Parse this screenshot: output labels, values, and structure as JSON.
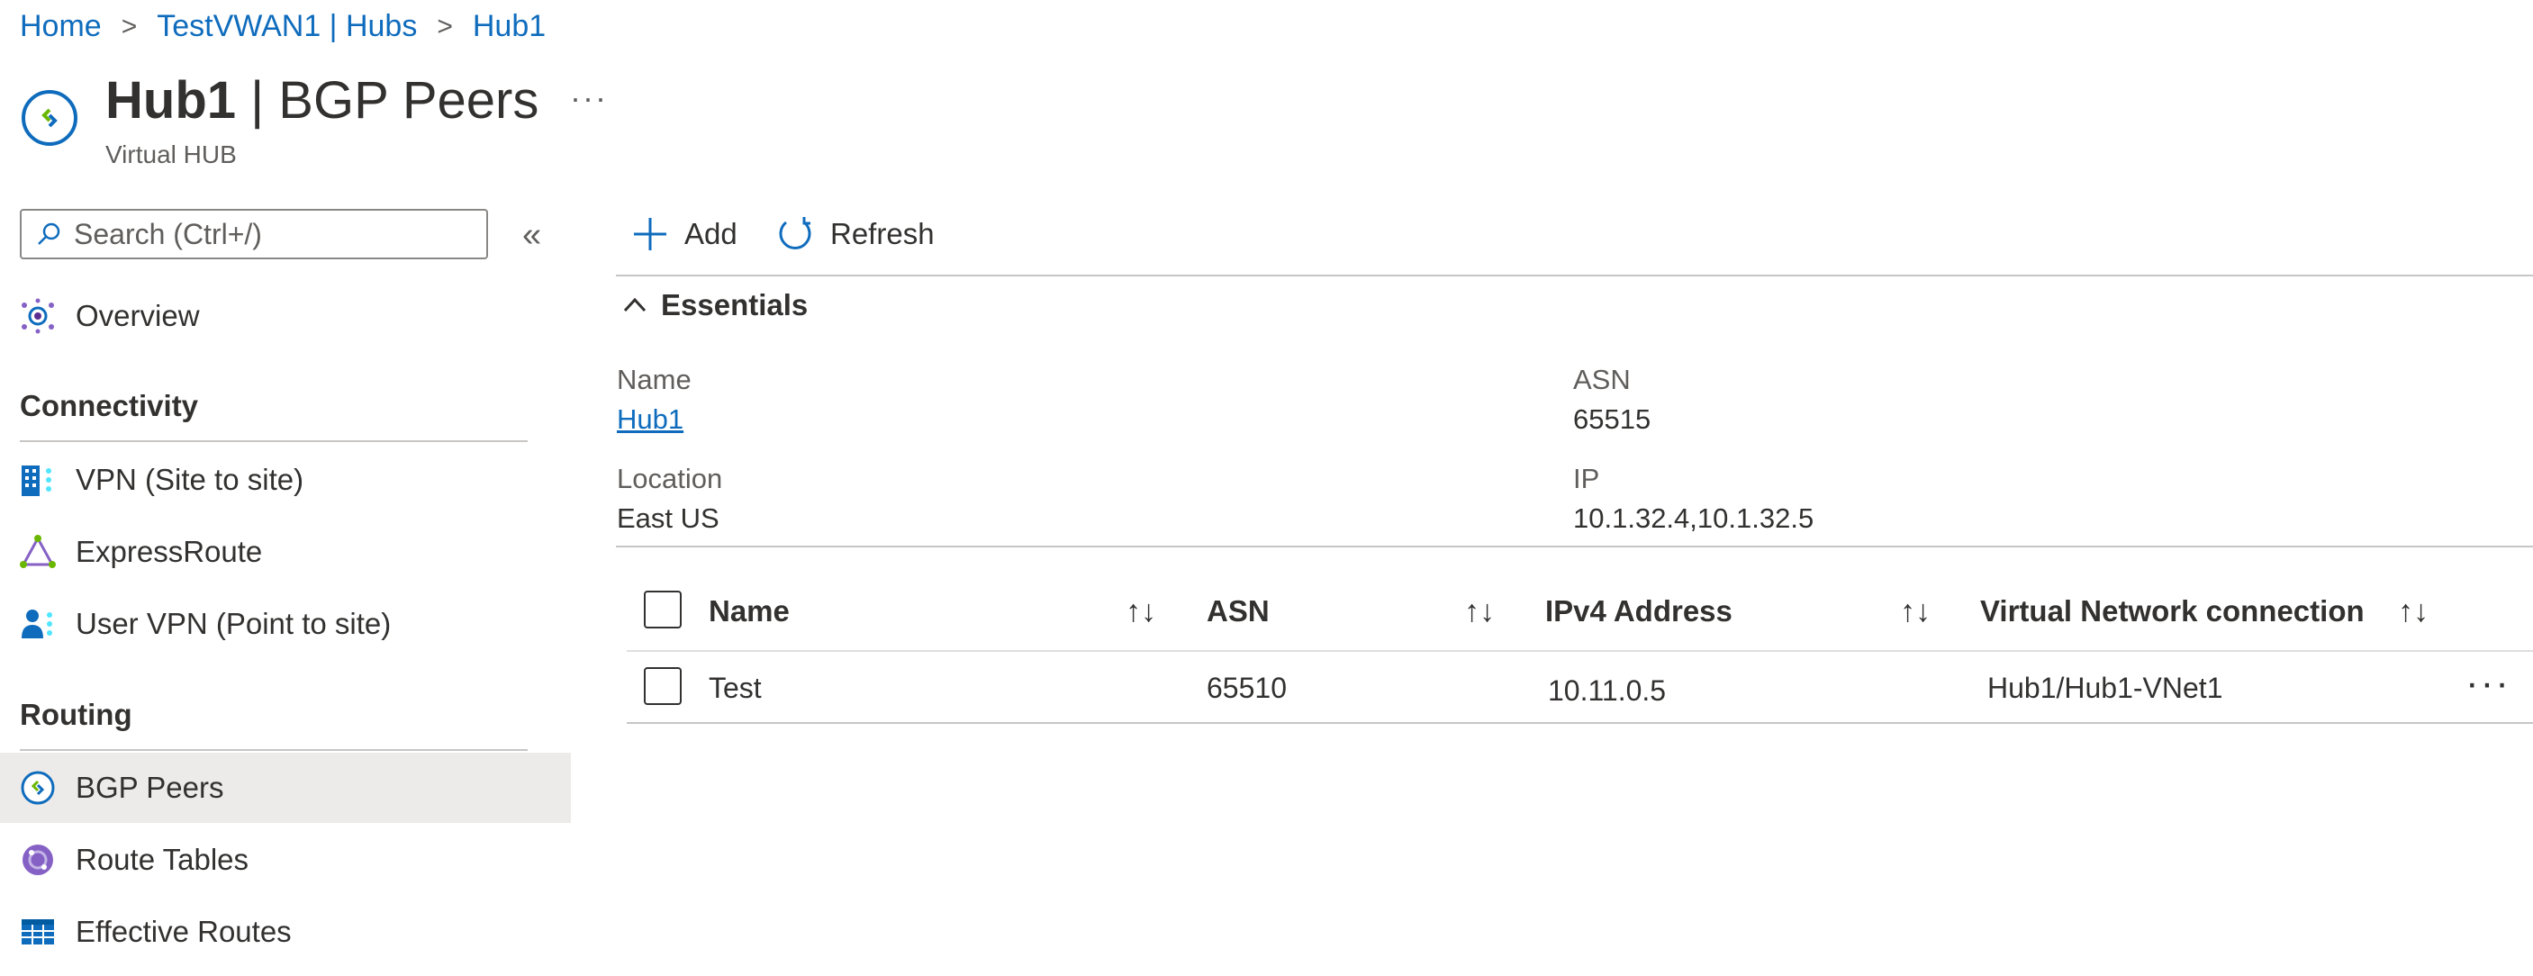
{
  "breadcrumb": [
    "Home",
    "TestVWAN1 | Hubs",
    "Hub1"
  ],
  "header": {
    "title_bold": "Hub1",
    "title_rest": "| BGP Peers",
    "subtitle": "Virtual HUB",
    "more": "···"
  },
  "sidebar": {
    "search_placeholder": "Search (Ctrl+/)",
    "collapse": "«",
    "overview": "Overview",
    "sections": [
      {
        "title": "Connectivity",
        "items": [
          "VPN (Site to site)",
          "ExpressRoute",
          "User VPN (Point to site)"
        ]
      },
      {
        "title": "Routing",
        "items": [
          "BGP Peers",
          "Route Tables",
          "Effective Routes"
        ]
      }
    ],
    "active_item": "BGP Peers"
  },
  "toolbar": {
    "add": "Add",
    "refresh": "Refresh"
  },
  "essentials": {
    "title": "Essentials",
    "name_label": "Name",
    "name_value": "Hub1",
    "asn_label": "ASN",
    "asn_value": "65515",
    "location_label": "Location",
    "location_value": "East US",
    "ip_label": "IP",
    "ip_value": "10.1.32.4,10.1.32.5"
  },
  "table": {
    "columns": [
      "Name",
      "ASN",
      "IPv4 Address",
      "Virtual Network connection"
    ],
    "sort_glyph": "↑↓",
    "rows": [
      {
        "name": "Test",
        "asn": "65510",
        "ipv4": "10.11.0.5",
        "vnet": "Hub1/Hub1-VNet1",
        "more": "···"
      }
    ]
  },
  "colors": {
    "link": "#0f6cbd",
    "active_bg": "#edebe9",
    "divider": "#c8c6c4"
  }
}
